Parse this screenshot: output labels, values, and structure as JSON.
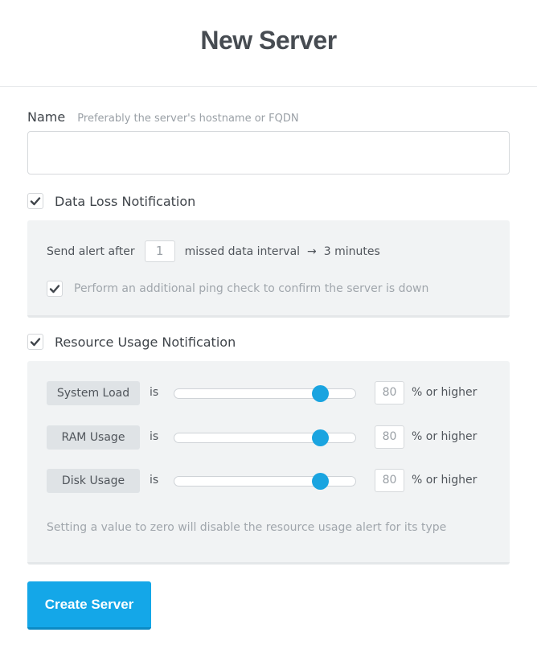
{
  "page": {
    "title": "New Server"
  },
  "name_field": {
    "label": "Name",
    "hint": "Preferably the server's hostname or FQDN",
    "value": "",
    "placeholder": ""
  },
  "data_loss": {
    "label": "Data Loss Notification",
    "checked": true,
    "send_alert_prefix": "Send alert after",
    "interval_value": "1",
    "send_alert_suffix": "missed data interval",
    "arrow": "→",
    "duration": "3 minutes",
    "ping_check_label": "Perform an additional ping check to confirm the server is down",
    "ping_check_checked": true
  },
  "resource_usage": {
    "label": "Resource Usage Notification",
    "checked": true,
    "is_text": "is",
    "suffix": "% or higher",
    "items": [
      {
        "label": "System Load",
        "value": "80",
        "percent": 80
      },
      {
        "label": "RAM Usage",
        "value": "80",
        "percent": 80
      },
      {
        "label": "Disk Usage",
        "value": "80",
        "percent": 80
      }
    ],
    "hint": "Setting a value to zero will disable the resource usage alert for its type"
  },
  "submit": {
    "label": "Create Server"
  },
  "colors": {
    "accent": "#14a7e8",
    "panel": "#f1f3f4",
    "check": "#3f444a"
  },
  "icons": {
    "checkbox": "check-icon"
  }
}
